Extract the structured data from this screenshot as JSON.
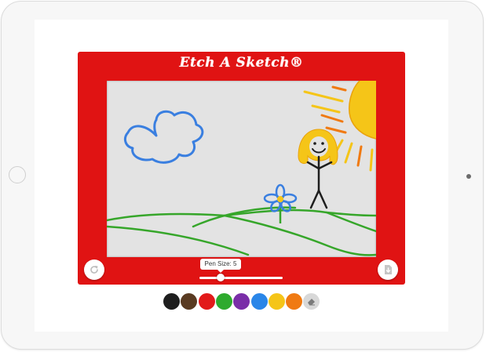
{
  "app": {
    "brand": "Etch A Sketch®"
  },
  "controls": {
    "pen_size_label": "Pen Size: 5",
    "pen_size_value": 5,
    "pen_size_fraction": 0.25,
    "reset_icon": "refresh-icon",
    "save_icon": "save-download-icon"
  },
  "palette": {
    "colors": [
      "#1e1e1e",
      "#5a3b22",
      "#e21a1a",
      "#2eaa2e",
      "#7a2ea8",
      "#2a86e8",
      "#f5c518",
      "#f07a12"
    ],
    "eraser_icon": "eraser-icon"
  },
  "drawing": {
    "frame_color": "#e01313",
    "board_color": "#e3e3e3",
    "sky_elements": [
      "cloud",
      "sun"
    ],
    "scene_elements": [
      "stick-figure",
      "flower",
      "hills"
    ]
  }
}
